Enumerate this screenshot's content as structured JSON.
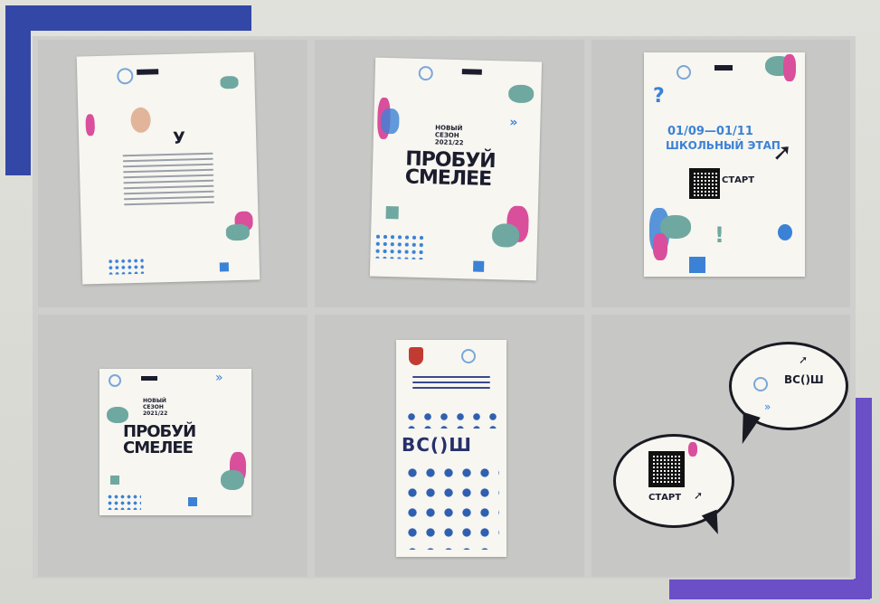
{
  "posters": {
    "letter": {
      "heading": "У"
    },
    "main": {
      "subtitle_lines": [
        "НОВЫЙ",
        "СЕЗОН",
        "2021/22"
      ],
      "title_line1": "ПРОБУЙ",
      "title_line2": "СМЕЛЕЕ"
    },
    "school": {
      "question_mark": "?",
      "dates": "01/09—01/11",
      "stage": "ШКОЛЬНЫЙ ЭТАП",
      "button": "СТАРТ",
      "exclamation": "!"
    },
    "small": {
      "subtitle_lines": [
        "НОВЫЙ",
        "СЕЗОН",
        "2021/22"
      ],
      "title_line1": "ПРОБУЙ",
      "title_line2": "СМЕЛЕЕ"
    },
    "vsosh": {
      "logo_text": "ВС()Ш"
    }
  },
  "bubbles": {
    "logo_text": "ВС()Ш",
    "button": "СТАРТ"
  },
  "colors": {
    "navy": "#1b1d2e",
    "blue": "#3b82d6",
    "teal": "#6fa8a0",
    "pink": "#d94f9c",
    "purple": "#8a64c9",
    "frame_blue": "#3347a6",
    "frame_violet": "#6a4fc7"
  }
}
